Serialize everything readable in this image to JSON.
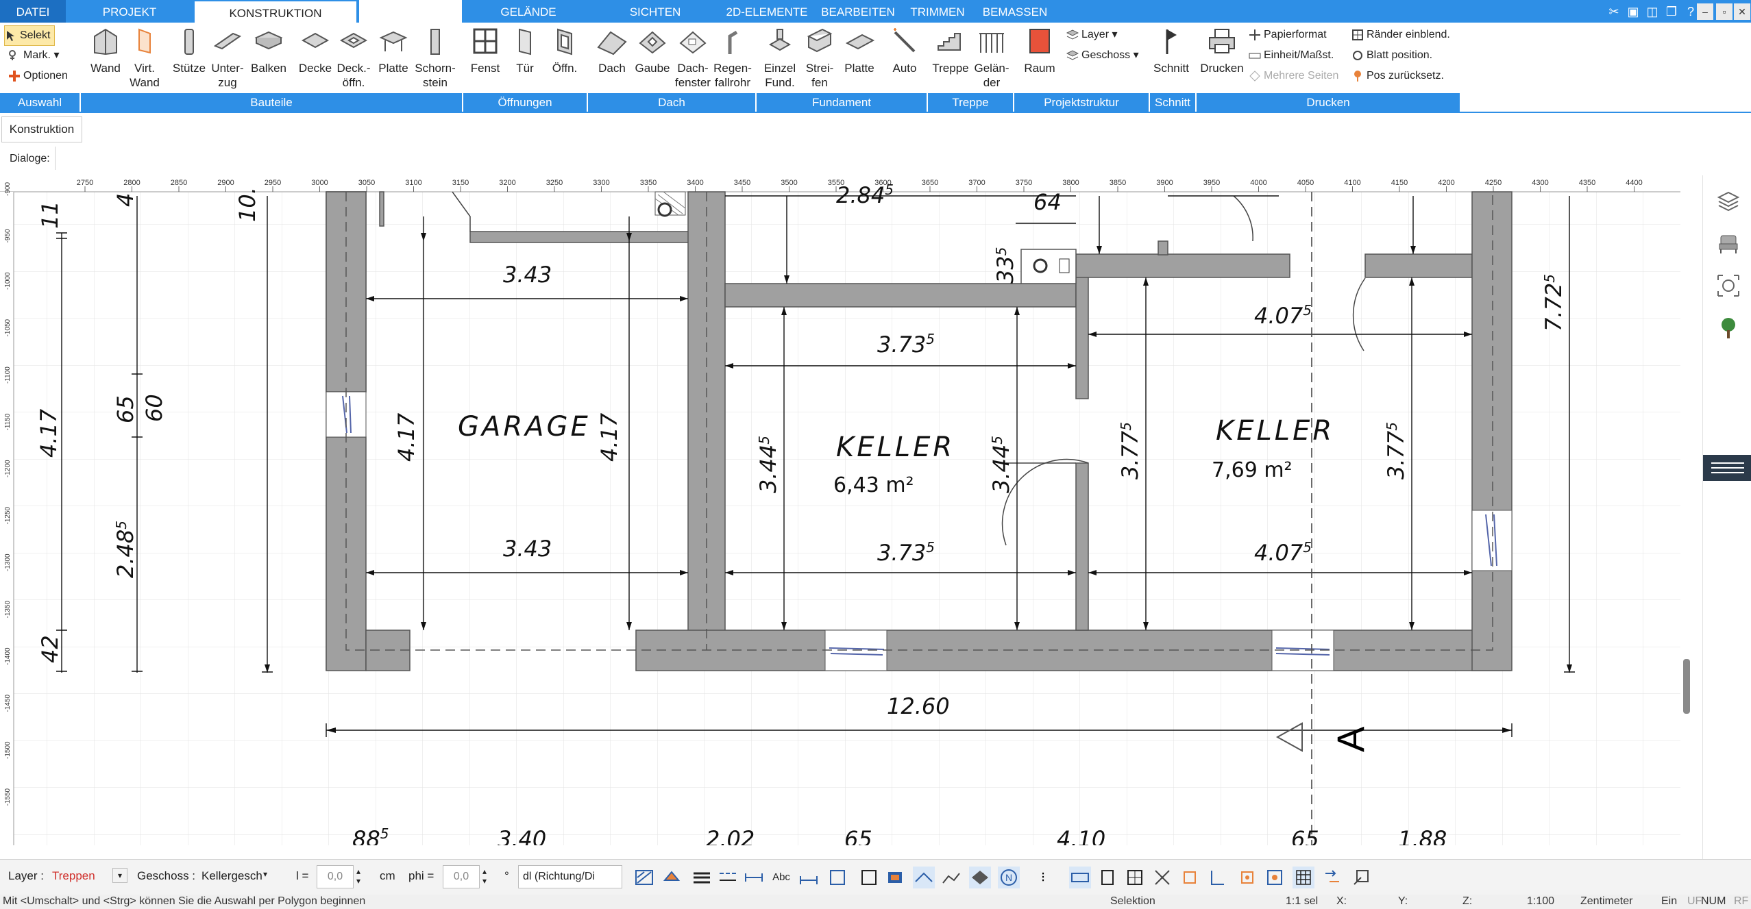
{
  "tabs": [
    {
      "label": "DATEI"
    },
    {
      "label": "PROJEKT"
    },
    {
      "label": "KONSTRUKTION"
    },
    {
      "label": ""
    },
    {
      "label": "GELÄNDE"
    },
    {
      "label": "SICHTEN"
    },
    {
      "label": "2D-ELEMENTE"
    },
    {
      "label": "BEARBEITEN"
    },
    {
      "label": "TRIMMEN"
    },
    {
      "label": "BEMASSEN"
    }
  ],
  "ribbon": {
    "auswahl": {
      "selekt": "Selekt",
      "mark": "Mark.",
      "optionen": "Optionen"
    },
    "buttons": [
      {
        "label": "Wand"
      },
      {
        "label": "Virt.\nWand"
      },
      {
        "label": "Stütze"
      },
      {
        "label": "Unter-\nzug"
      },
      {
        "label": "Balken"
      },
      {
        "label": "Decke"
      },
      {
        "label": "Deck.-\nöffn."
      },
      {
        "label": "Platte"
      },
      {
        "label": "Schorn-\nstein"
      },
      {
        "label": "Fenst"
      },
      {
        "label": "Tür"
      },
      {
        "label": "Öffn."
      },
      {
        "label": "Dach"
      },
      {
        "label": "Gaube"
      },
      {
        "label": "Dach-\nfenster"
      },
      {
        "label": "Regen-\nfallrohr"
      },
      {
        "label": "Einzel\nFund."
      },
      {
        "label": "Strei-\nfen"
      },
      {
        "label": "Platte"
      },
      {
        "label": "Auto"
      },
      {
        "label": "Treppe"
      },
      {
        "label": "Gelän-\nder"
      },
      {
        "label": "Raum"
      },
      {
        "label": "Schnitt"
      },
      {
        "label": "Drucken"
      }
    ],
    "projekt": {
      "layer": "Layer",
      "geschoss": "Geschoss"
    },
    "drucken_small": {
      "papierformat": "Papierformat",
      "einheit": "Einheit/Maßst.",
      "mehrere": "Mehrere Seiten",
      "raender": "Ränder einblend.",
      "blatt": "Blatt position.",
      "pos": "Pos zurücksetz."
    },
    "groups": [
      {
        "label": "Auswahl"
      },
      {
        "label": "Bauteile"
      },
      {
        "label": "Öffnungen"
      },
      {
        "label": "Dach"
      },
      {
        "label": "Fundament"
      },
      {
        "label": "Treppe"
      },
      {
        "label": "Projektstruktur"
      },
      {
        "label": "Schnitt"
      },
      {
        "label": "Drucken"
      }
    ]
  },
  "dialog": {
    "konstruktion": "Konstruktion",
    "dialoge_label": "Dialoge:"
  },
  "ruler": {
    "top_ticks": [
      "2750",
      "2800",
      "2850",
      "2900",
      "2950",
      "3000",
      "3050",
      "3100",
      "3150",
      "3200",
      "3250",
      "3300",
      "3350",
      "3400",
      "3450",
      "3500",
      "3550",
      "3600",
      "3650",
      "3700",
      "3750",
      "3800",
      "3850",
      "3900",
      "3950",
      "4000",
      "4050",
      "4100",
      "4150",
      "4200",
      "4250",
      "4300",
      "4350",
      "4400"
    ],
    "left_ticks": [
      "-900",
      "-950",
      "-1000",
      "-1050",
      "-1100",
      "-1150",
      "-1200",
      "-1250",
      "-1300",
      "-1350",
      "-1400",
      "-1450",
      "-1500",
      "-1550"
    ]
  },
  "plan": {
    "rooms": [
      {
        "name": "GARAGE",
        "area": ""
      },
      {
        "name": "KELLER",
        "area": "6,43 m²"
      },
      {
        "name": "KELLER",
        "area": "7,69 m²"
      }
    ],
    "dims": {
      "d284": "2.84",
      "d284s": "5",
      "d64": "64",
      "d335": "33",
      "d335s": "5",
      "g343a": "3.43",
      "g343b": "3.43",
      "g417a": "4.17",
      "g417b": "4.17",
      "k373a": "3.73",
      "k373as": "5",
      "k373b": "3.73",
      "k373bs": "5",
      "k344a": "3.44",
      "k344as": "5",
      "k344b": "3.44",
      "k344bs": "5",
      "r407a": "4.07",
      "r407as": "5",
      "r407b": "4.07",
      "r407bs": "5",
      "r377a": "3.77",
      "r377as": "5",
      "r377b": "3.77",
      "r377bs": "5",
      "total": "12.60",
      "side772": "7.72",
      "side772s": "5",
      "left417": "4.17",
      "left11": "11",
      "left4": "4",
      "left10": "10.",
      "left65": "65",
      "left60": "60",
      "left248": "2.48",
      "left248s": "5",
      "left42": "42",
      "bottom1": "88",
      "bottom1s": "5",
      "bottom2": "3.40",
      "bottom3": "2.02",
      "bottom4": "65",
      "bottom5": "4.10",
      "bottom6": "65",
      "bottom7": "1.88",
      "section": "A"
    }
  },
  "bottombar": {
    "layer_label": "Layer :",
    "layer_value": "Treppen",
    "geschoss_label": "Geschoss :",
    "geschoss_value": "Kellergesch",
    "l_label": "l =",
    "l_value": "0,0",
    "l_unit": "cm",
    "phi_label": "phi =",
    "phi_value": "0,0",
    "phi_unit": "°",
    "dl_value": "dl (Richtung/Di"
  },
  "statusbar": {
    "hint": "Mit <Umschalt> und <Strg> können Sie die Auswahl per Polygon beginnen",
    "mode": "Selektion",
    "sel": "1:1 sel",
    "x": "X:",
    "y": "Y:",
    "z": "Z:",
    "scale": "1:100",
    "unit": "Zentimeter",
    "ein": "Ein",
    "uf": "UF",
    "num": "NUM",
    "rf": "RF"
  },
  "colors": {
    "accent": "#2e8fe6",
    "wall": "#a0a0a0",
    "red_value": "#d0312d"
  }
}
